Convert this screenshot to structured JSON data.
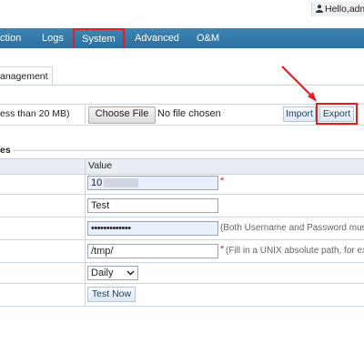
{
  "header": {
    "user_text": "Hello,admi"
  },
  "nav": {
    "items": [
      "ction",
      "Logs",
      "System",
      "Advanced",
      "O&M"
    ],
    "active": "System"
  },
  "tab": {
    "label": "anagement"
  },
  "upload": {
    "label": "ess than 20 MB)",
    "choose_button": "Choose File",
    "file_status": "No file chosen",
    "import_button": "Import",
    "export_button": "Export"
  },
  "section": {
    "title": "es"
  },
  "table": {
    "value_header": "Value"
  },
  "fields": {
    "ip": {
      "value": "10"
    },
    "name": {
      "value": "Test"
    },
    "password": {
      "value": "•••••••••••••",
      "hint": "(Both Username and Password must"
    },
    "path": {
      "value": "/tmp/",
      "hint": "(Fill in a UNIX absolute path, for ex"
    },
    "frequency": {
      "value": "Daily"
    },
    "test_button": "Test Now"
  },
  "required_mark": "*",
  "colors": {
    "nav_bg": "#2f78a8",
    "highlight": "#e02020"
  }
}
